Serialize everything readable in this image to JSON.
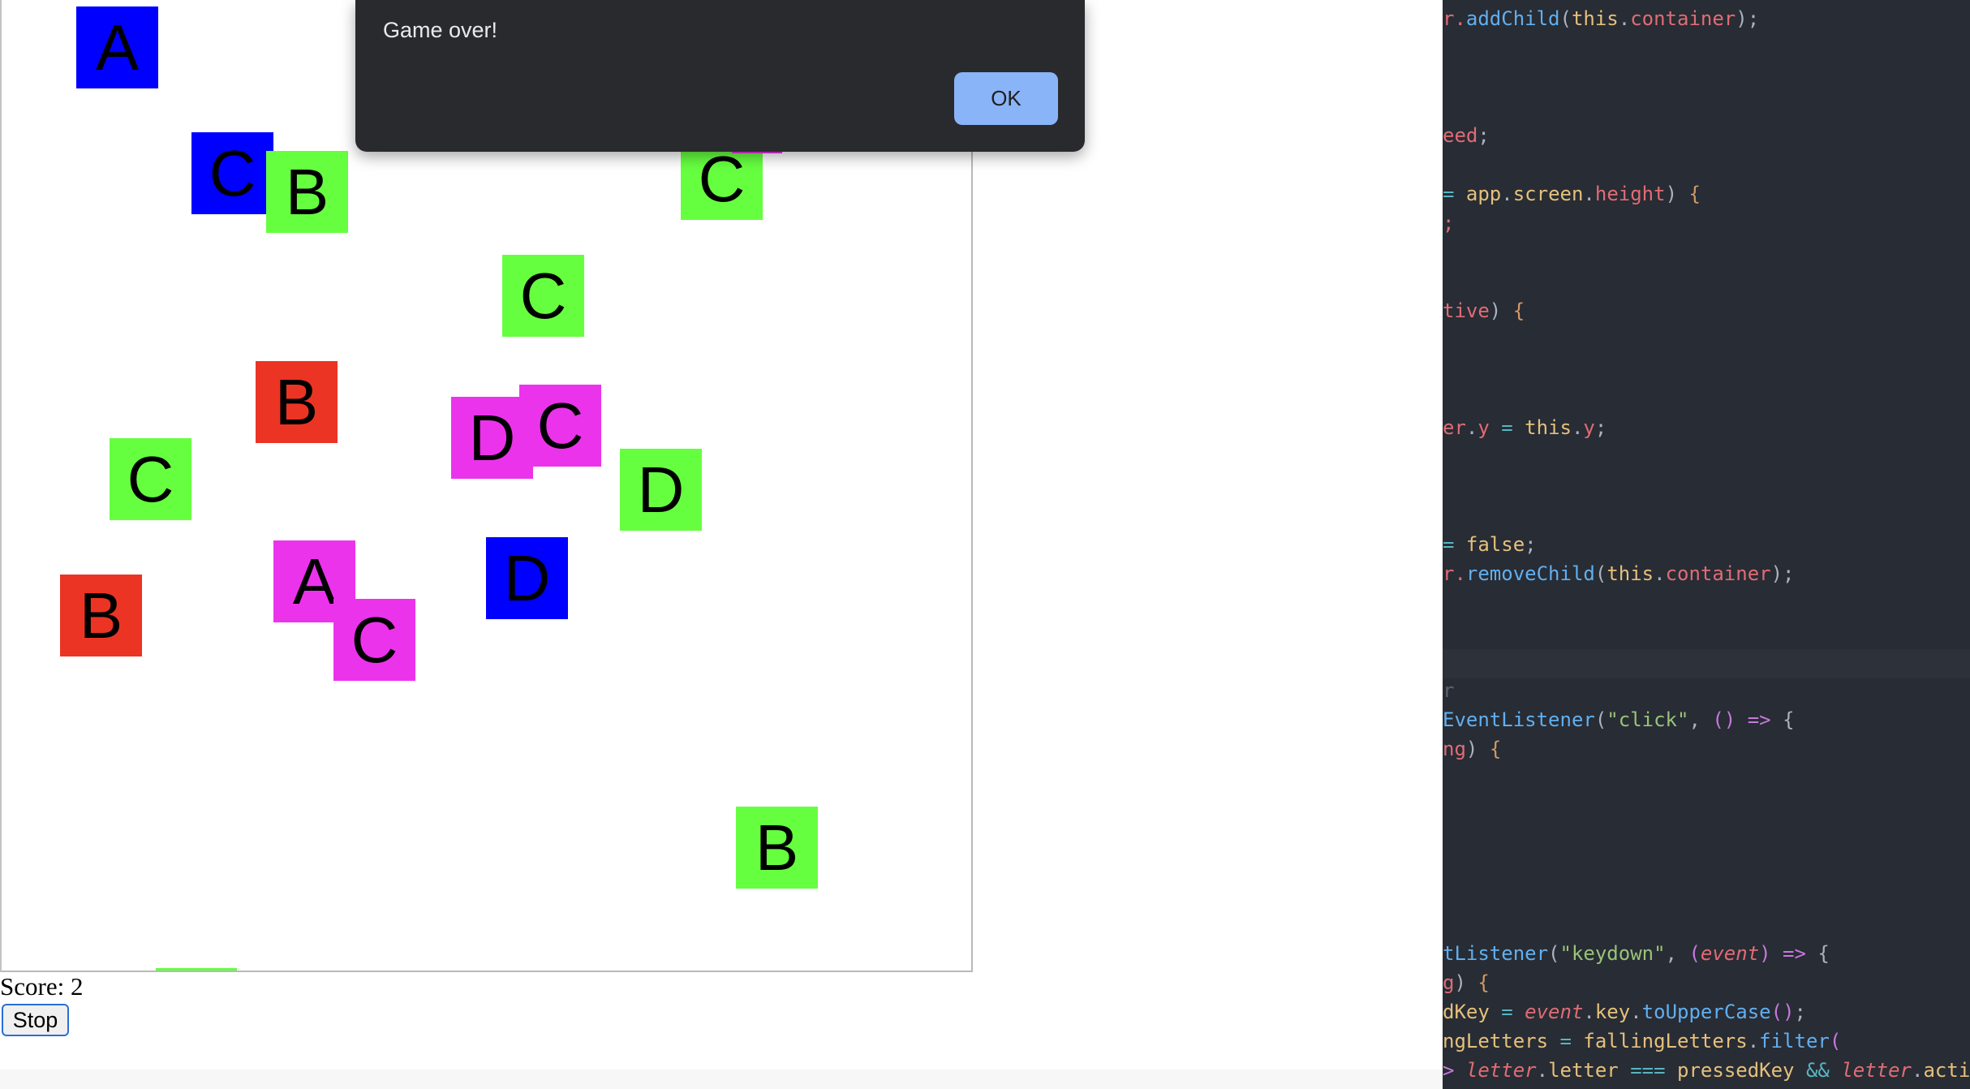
{
  "game": {
    "tiles": [
      {
        "letter": "A",
        "color": "#0000ff"
      },
      {
        "letter": "C",
        "color": "#0000ff"
      },
      {
        "letter": "B",
        "color": "#66ff40"
      },
      {
        "letter": "C",
        "color": "#66ff40"
      },
      {
        "letter": "C",
        "color": "#66ff40"
      },
      {
        "letter": "B",
        "color": "#ec3424"
      },
      {
        "letter": "D",
        "color": "#ec33ec"
      },
      {
        "letter": "C",
        "color": "#ec33ec"
      },
      {
        "letter": "C",
        "color": "#66ff40"
      },
      {
        "letter": "D",
        "color": "#66ff40"
      },
      {
        "letter": "A",
        "color": "#ec33ec"
      },
      {
        "letter": "D",
        "color": "#0000ff"
      },
      {
        "letter": "B",
        "color": "#ec3424"
      },
      {
        "letter": "C",
        "color": "#ec33ec"
      },
      {
        "letter": "B",
        "color": "#66ff40"
      }
    ],
    "score_label": "Score: 2",
    "stop_label": "Stop"
  },
  "alert": {
    "message": "Game over!",
    "ok_label": "OK"
  },
  "editor": {
    "lines": [
      [
        [
          "r.",
          "t-prop"
        ],
        [
          "addChild",
          "t-fn"
        ],
        [
          "(",
          "t-plain"
        ],
        [
          "this",
          "t-kw"
        ],
        [
          ".",
          "t-plain"
        ],
        [
          "container",
          "t-prop"
        ],
        [
          ");",
          "t-plain"
        ]
      ],
      [
        [
          "eed",
          "t-prop"
        ],
        [
          ";",
          "t-plain"
        ]
      ],
      [
        [
          "= ",
          "t-op"
        ],
        [
          "app",
          "t-kw"
        ],
        [
          ".",
          "t-plain"
        ],
        [
          "screen",
          "t-kw"
        ],
        [
          ".",
          "t-plain"
        ],
        [
          "height",
          "t-prop"
        ],
        [
          ") ",
          "t-plain"
        ],
        [
          "{",
          "t-brace"
        ]
      ],
      [
        [
          ";",
          "t-prop"
        ]
      ],
      [
        [
          "tive",
          "t-prop"
        ],
        [
          ") ",
          "t-plain"
        ],
        [
          "{",
          "t-brace"
        ]
      ],
      [
        [
          "er",
          "t-prop"
        ],
        [
          ".",
          "t-plain"
        ],
        [
          "y",
          "t-prop"
        ],
        [
          " = ",
          "t-op"
        ],
        [
          "this",
          "t-kw"
        ],
        [
          ".",
          "t-plain"
        ],
        [
          "y",
          "t-prop"
        ],
        [
          ";",
          "t-plain"
        ]
      ],
      [
        [
          "= ",
          "t-op"
        ],
        [
          "false",
          "t-kw"
        ],
        [
          ";",
          "t-plain"
        ]
      ],
      [
        [
          "r.",
          "t-prop"
        ],
        [
          "removeChild",
          "t-fn"
        ],
        [
          "(",
          "t-plain"
        ],
        [
          "this",
          "t-kw"
        ],
        [
          ".",
          "t-plain"
        ],
        [
          "container",
          "t-prop"
        ],
        [
          ");",
          "t-plain"
        ]
      ],
      [
        [
          "r",
          "t-dim"
        ]
      ],
      [
        [
          "EventListener",
          "t-fn"
        ],
        [
          "(",
          "t-plain"
        ],
        [
          "\"click\"",
          "t-str"
        ],
        [
          ", ",
          "t-plain"
        ],
        [
          "()",
          "t-mag"
        ],
        [
          " => ",
          "t-mag"
        ],
        [
          "{",
          "t-plain"
        ]
      ],
      [
        [
          "ng",
          "t-prop"
        ],
        [
          ") ",
          "t-plain"
        ],
        [
          "{",
          "t-brace"
        ]
      ],
      [
        [
          "tListener",
          "t-fn"
        ],
        [
          "(",
          "t-plain"
        ],
        [
          "\"keydown\"",
          "t-str"
        ],
        [
          ", ",
          "t-plain"
        ],
        [
          "(",
          "t-mag"
        ],
        [
          "event",
          "t-it"
        ],
        [
          ")",
          "t-mag"
        ],
        [
          " => ",
          "t-mag"
        ],
        [
          "{",
          "t-plain"
        ]
      ],
      [
        [
          "g",
          "t-prop"
        ],
        [
          ") ",
          "t-plain"
        ],
        [
          "{",
          "t-brace"
        ]
      ],
      [
        [
          "dKey",
          "t-kw"
        ],
        [
          " = ",
          "t-op"
        ],
        [
          "event",
          "t-it"
        ],
        [
          ".",
          "t-plain"
        ],
        [
          "key",
          "t-kw"
        ],
        [
          ".",
          "t-plain"
        ],
        [
          "toUpperCase",
          "t-fn"
        ],
        [
          "()",
          "t-mag"
        ],
        [
          ";",
          "t-plain"
        ]
      ],
      [
        [
          "ngLetters",
          "t-kw"
        ],
        [
          " = ",
          "t-op"
        ],
        [
          "fallingLetters",
          "t-kw"
        ],
        [
          ".",
          "t-plain"
        ],
        [
          "filter",
          "t-fn"
        ],
        [
          "(",
          "t-mag"
        ]
      ],
      [
        [
          "> ",
          "t-mag"
        ],
        [
          "letter",
          "t-it"
        ],
        [
          ".",
          "t-plain"
        ],
        [
          "letter",
          "t-kw"
        ],
        [
          " === ",
          "t-op"
        ],
        [
          "pressedKey",
          "t-kw"
        ],
        [
          " && ",
          "t-op"
        ],
        [
          "letter",
          "t-it"
        ],
        [
          ".",
          "t-plain"
        ],
        [
          "activ",
          "t-kw"
        ]
      ]
    ]
  }
}
